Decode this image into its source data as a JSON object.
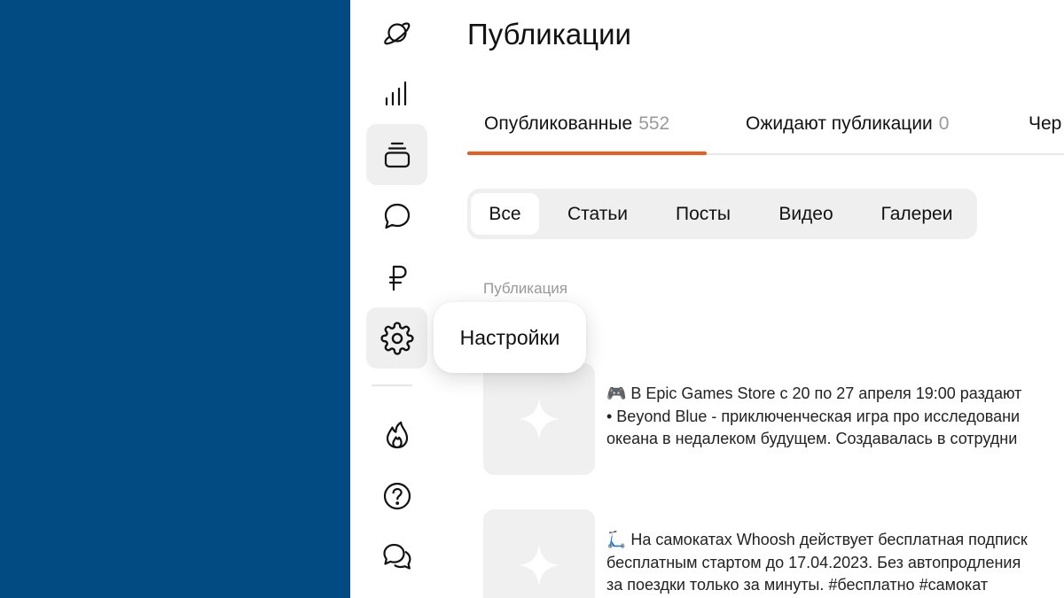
{
  "page": {
    "title": "Публикации"
  },
  "sidebar": {
    "items": [
      {
        "icon": "planet-icon",
        "state": "default"
      },
      {
        "icon": "bar-chart-icon",
        "state": "default"
      },
      {
        "icon": "publications-stack-icon",
        "state": "active"
      },
      {
        "icon": "chat-bubble-icon",
        "state": "default"
      },
      {
        "icon": "ruble-icon",
        "state": "default"
      },
      {
        "icon": "gear-icon",
        "state": "hover"
      },
      {
        "icon": "flame-icon",
        "state": "default"
      },
      {
        "icon": "help-circle-icon",
        "state": "default"
      },
      {
        "icon": "chats-icon",
        "state": "default"
      }
    ],
    "tooltip": "Настройки"
  },
  "tabs": [
    {
      "label": "Опубликованные",
      "count": "552"
    },
    {
      "label": "Ожидают публикации",
      "count": "0"
    },
    {
      "label": "Чер",
      "count": ""
    }
  ],
  "filters": {
    "items": [
      "Все",
      "Статьи",
      "Посты",
      "Видео",
      "Галереи"
    ],
    "selected": "Все"
  },
  "list": {
    "column_header": "Публикация",
    "posts": [
      {
        "thumb_icon": "sparkle-icon",
        "lines": [
          "🎮 В Epic Games Store с 20 по 27 апреля 19:00 раздают",
          "• Beyond Blue - приключенческая игра про исследовани",
          "океана в недалеком будущем. Создавалась в сотрудни"
        ]
      },
      {
        "thumb_icon": "sparkle-icon",
        "lines": [
          "🛴 На самокатах Whoosh действует бесплатная подписк",
          "бесплатным стартом до 17.04.2023. Без автопродления",
          "за поездки только за минуты. #бесплатно #самокат"
        ]
      }
    ]
  },
  "colors": {
    "left_background": "#024a82",
    "accent_underline": "#f05a1c",
    "chip_background": "#efefef",
    "muted_text": "#9a9a9a"
  }
}
